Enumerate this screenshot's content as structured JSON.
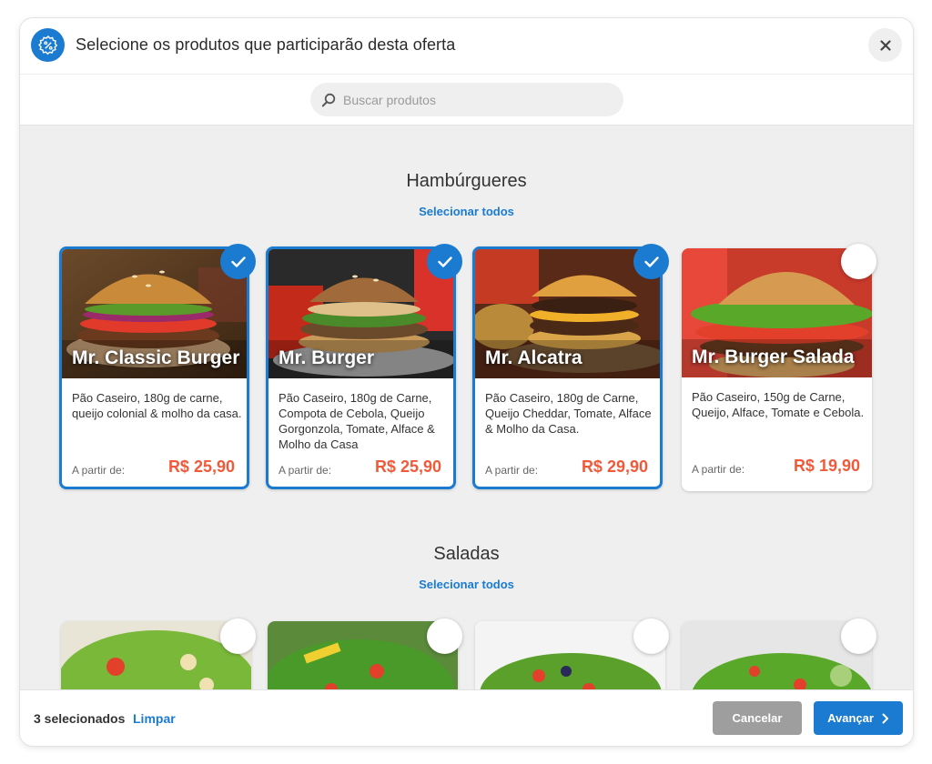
{
  "header": {
    "title": "Selecione os produtos que participarão desta oferta",
    "icon": "offer-percent-icon",
    "close_icon": "close-icon"
  },
  "search": {
    "placeholder": "Buscar produtos",
    "value": ""
  },
  "sections": [
    {
      "title": "Hambúrgueres",
      "select_all": "Selecionar todos",
      "products": [
        {
          "name": "Mr. Classic Burger",
          "description": "Pão Caseiro, 180g de carne, queijo colonial & molho da casa.",
          "from_label": "A partir de:",
          "price": "R$ 25,90",
          "selected": true
        },
        {
          "name": "Mr. Burger",
          "description": "Pão Caseiro, 180g de Carne, Compota de Cebola, Queijo Gorgonzola, Tomate, Alface & Molho da Casa",
          "from_label": "A partir de:",
          "price": "R$ 25,90",
          "selected": true
        },
        {
          "name": "Mr. Alcatra",
          "description": "Pão Caseiro, 180g de Carne, Queijo Cheddar, Tomate, Alface & Molho da Casa.",
          "from_label": "A partir de:",
          "price": "R$ 29,90",
          "selected": true
        },
        {
          "name": "Mr. Burger Salada",
          "description": "Pão Caseiro, 150g de Carne, Queijo, Alface, Tomate e Cebola.",
          "from_label": "A partir de:",
          "price": "R$ 19,90",
          "selected": false
        }
      ]
    },
    {
      "title": "Saladas",
      "select_all": "Selecionar todos"
    }
  ],
  "footer": {
    "selected_count": "3 selecionados",
    "clear_label": "Limpar",
    "cancel_label": "Cancelar",
    "next_label": "Avançar"
  },
  "colors": {
    "accent": "#1a7bd1",
    "price": "#f05a3a",
    "cancel": "#9e9e9e"
  }
}
